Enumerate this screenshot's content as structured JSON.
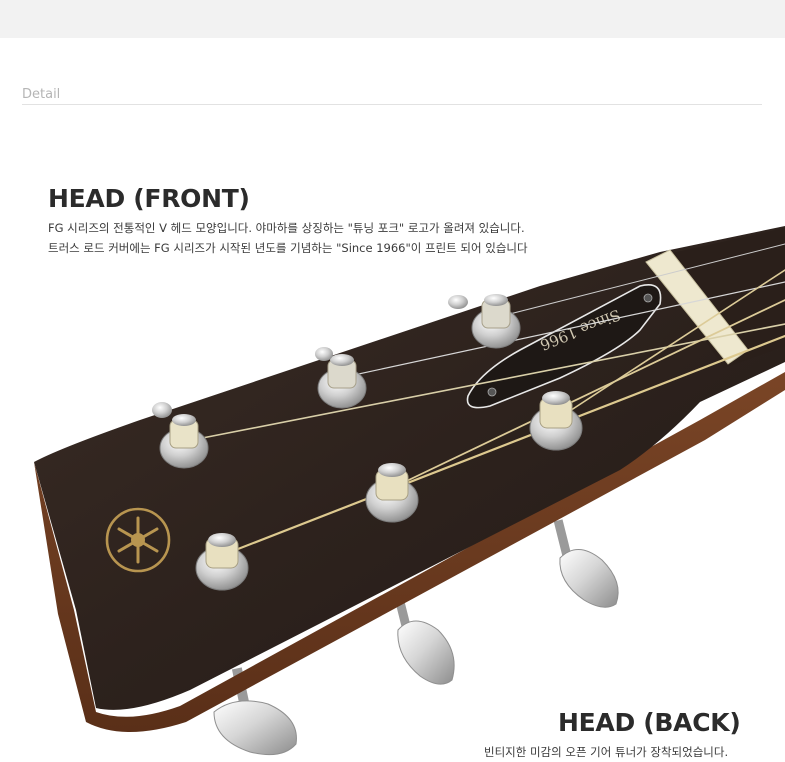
{
  "detail": {
    "label": "Detail"
  },
  "front": {
    "title": "HEAD (FRONT)",
    "line1": "FG 시리즈의 전통적인 V 헤드 모양입니다. 야마하를 상징하는 \"튜닝 포크\" 로고가 올려져 있습니다.",
    "line2": "트러스 로드 커버에는 FG 시리즈가 시작된 년도를 기념하는 \"Since 1966\"이 프린트 되어 있습니다"
  },
  "back": {
    "title": "HEAD (BACK)",
    "line1": "빈티지한 미감의 오픈 기어 튜너가 장착되었습니다."
  },
  "photo": {
    "truss_text": "Since 1966",
    "colors": {
      "headstock": "#2d221d",
      "wood_side": "#6e3e22",
      "chrome": "#d9d9d9",
      "nut": "#efe9cf",
      "logo": "#b89550"
    }
  }
}
